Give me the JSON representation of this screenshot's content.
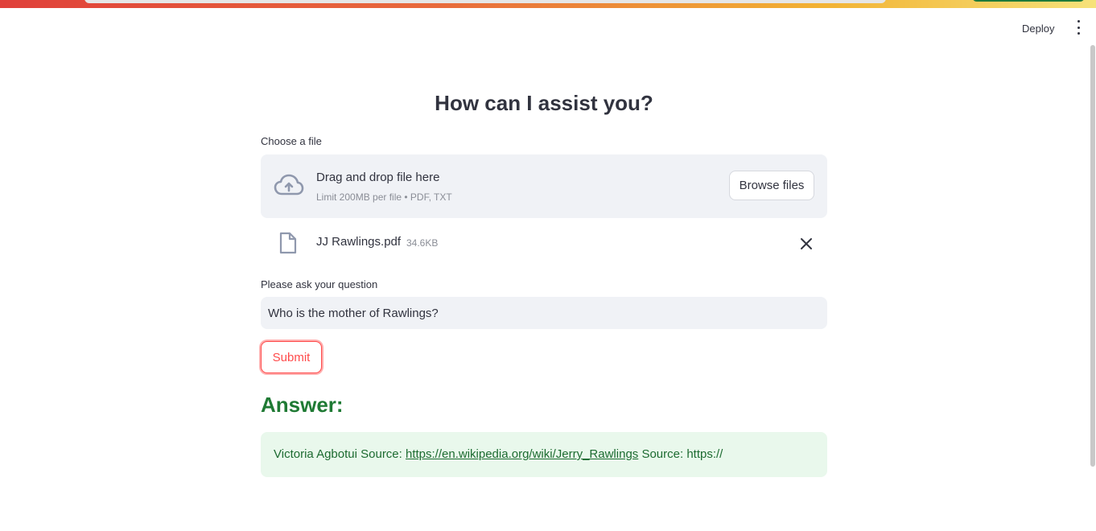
{
  "header": {
    "deploy_label": "Deploy",
    "menu_icon": "kebab-menu-icon"
  },
  "main": {
    "title": "How can I assist you?",
    "uploader": {
      "label": "Choose a file",
      "drop_title": "Drag and drop file here",
      "drop_limit": "Limit 200MB per file • PDF, TXT",
      "browse_label": "Browse files",
      "icon": "cloud-upload-icon"
    },
    "uploaded_file": {
      "name": "JJ Rawlings.pdf",
      "size": "34.6KB",
      "icon": "file-icon"
    },
    "question": {
      "label": "Please ask your question",
      "value": "Who is the mother of Rawlings?"
    },
    "submit_label": "Submit",
    "answer": {
      "heading": "Answer:",
      "text_before": "Victoria Agbotui Source: ",
      "link": "https://en.wikipedia.org/wiki/Jerry_Rawlings",
      "text_after": " Source: https://"
    }
  },
  "colors": {
    "accent": "#ff4b4b",
    "answer_heading": "#1f7a34",
    "answer_bg": "#e9f8ec",
    "input_bg": "#f0f2f6"
  }
}
